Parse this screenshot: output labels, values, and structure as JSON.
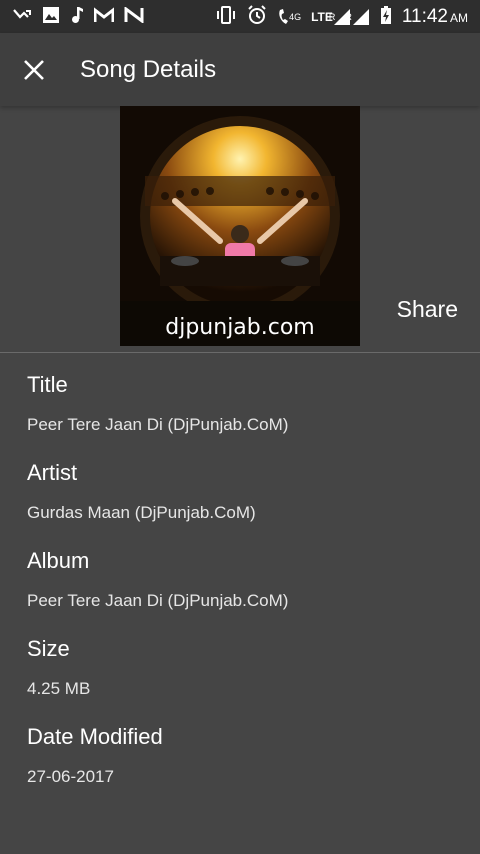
{
  "status_bar": {
    "time": "11:42",
    "ampm": "AM",
    "network_4g": "4G",
    "network_lte": "LTE",
    "roaming_1": "R",
    "roaming_2": "R",
    "icons": [
      "missed-call-icon",
      "image-icon",
      "music-note-icon",
      "gmail-icon",
      "n-app-icon",
      "vibrate-icon",
      "alarm-icon",
      "wifi-call-icon",
      "signal-icon",
      "signal-icon",
      "battery-charging-icon"
    ]
  },
  "app_bar": {
    "title": "Song Details",
    "close_icon": "close-icon"
  },
  "album_art": {
    "watermark": "djpunjab.com"
  },
  "share_label": "Share",
  "fields": [
    {
      "label": "Title",
      "value": "Peer Tere Jaan Di (DjPunjab.CoM)"
    },
    {
      "label": "Artist",
      "value": "Gurdas Maan (DjPunjab.CoM)"
    },
    {
      "label": "Album",
      "value": "Peer Tere Jaan Di (DjPunjab.CoM)"
    },
    {
      "label": "Size",
      "value": "4.25 MB"
    },
    {
      "label": "Date Modified",
      "value": "27-06-2017"
    }
  ],
  "colors": {
    "background": "#454545",
    "app_bar": "#3f3f3f",
    "status_bar": "#2e2e2e",
    "text": "#ffffff"
  }
}
